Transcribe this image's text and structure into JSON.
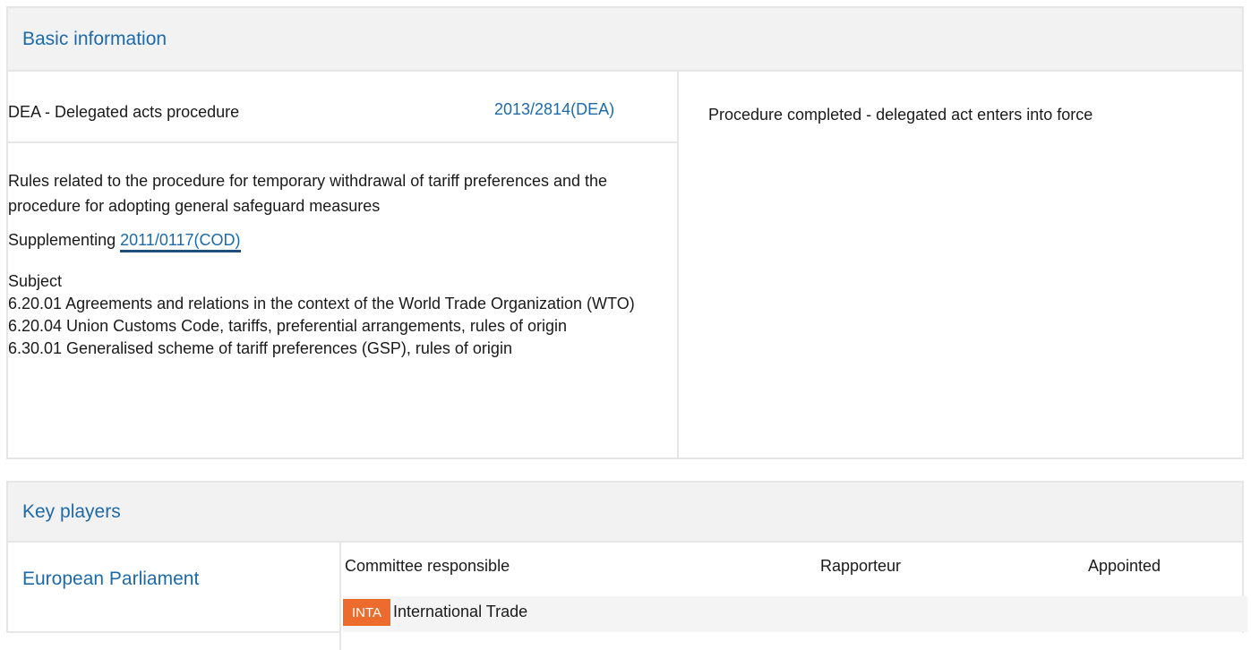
{
  "basic_information": {
    "title": "Basic information",
    "procedure_type": "DEA - Delegated acts procedure",
    "procedure_reference": "2013/2814(DEA)",
    "status": "Procedure completed - delegated act enters into force",
    "title_text": "Rules related to the procedure for temporary withdrawal of tariff preferences and the procedure for adopting general safeguard measures",
    "supplementing_label": "Supplementing",
    "supplementing_link": "2011/0117(COD)",
    "subject_label": "Subject",
    "subjects": [
      "6.20.01 Agreements and relations in the context of the World Trade Organization (WTO)",
      "6.20.04 Union Customs Code, tariffs, preferential arrangements, rules of origin",
      "6.30.01 Generalised scheme of tariff preferences (GSP), rules of origin"
    ]
  },
  "key_players": {
    "title": "Key players",
    "institution": "European Parliament",
    "columns": {
      "committee": "Committee responsible",
      "rapporteur": "Rapporteur",
      "appointed": "Appointed"
    },
    "committee": {
      "code": "INTA",
      "name": "International Trade"
    }
  },
  "colors": {
    "link": "#1e6aa8",
    "header_bg": "#f2f2f2",
    "border": "#e6e6e6",
    "badge": "#ec6b2d"
  }
}
